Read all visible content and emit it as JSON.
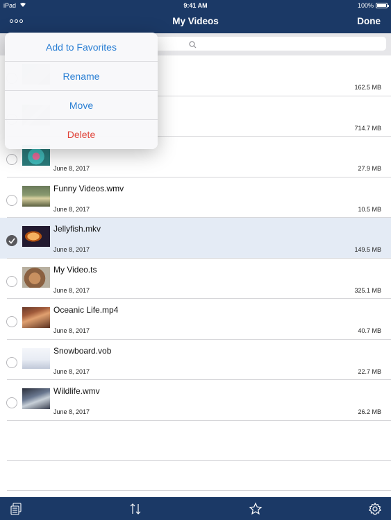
{
  "status_bar": {
    "carrier": "iPad",
    "time": "9:41 AM",
    "battery": "100%"
  },
  "nav": {
    "title": "My Videos",
    "done_label": "Done"
  },
  "search": {
    "placeholder": ""
  },
  "menu": {
    "items": [
      {
        "label": "Add to Favorites",
        "style": "normal"
      },
      {
        "label": "Rename",
        "style": "normal"
      },
      {
        "label": "Move",
        "style": "normal"
      },
      {
        "label": "Delete",
        "style": "destructive"
      }
    ]
  },
  "videos": [
    {
      "name": "",
      "date": "",
      "size": "162.5 MB",
      "selected": false,
      "thumb": "blurred"
    },
    {
      "name": "",
      "date": "",
      "size": "714.7 MB",
      "selected": false,
      "thumb": "blurred"
    },
    {
      "name": "",
      "date": "June 8, 2017",
      "size": "27.9 MB",
      "selected": false,
      "thumb": "parrot"
    },
    {
      "name": "Funny Videos.wmv",
      "date": "June 8, 2017",
      "size": "10.5 MB",
      "selected": false,
      "thumb": "field"
    },
    {
      "name": "Jellyfish.mkv",
      "date": "June 8, 2017",
      "size": "149.5 MB",
      "selected": true,
      "thumb": "jellyfish"
    },
    {
      "name": "My Video.ts",
      "date": "June 8, 2017",
      "size": "325.1 MB",
      "selected": false,
      "thumb": "lynx"
    },
    {
      "name": "Oceanic Life.mp4",
      "date": "June 8, 2017",
      "size": "40.7 MB",
      "selected": false,
      "thumb": "coral"
    },
    {
      "name": "Snowboard.vob",
      "date": "June 8, 2017",
      "size": "22.7 MB",
      "selected": false,
      "thumb": "snow"
    },
    {
      "name": "Wildlife.wmv",
      "date": "June 8, 2017",
      "size": "26.2 MB",
      "selected": false,
      "thumb": "wildlife"
    }
  ],
  "toolbar": {
    "buttons": [
      "files-icon",
      "sort-icon",
      "favorites-star-icon",
      "settings-gear-icon"
    ]
  },
  "colors": {
    "nav_background": "#1b3966",
    "accent_blue": "#2a7fd4",
    "destructive_red": "#e0443a",
    "selected_row": "#e4ebf5"
  }
}
